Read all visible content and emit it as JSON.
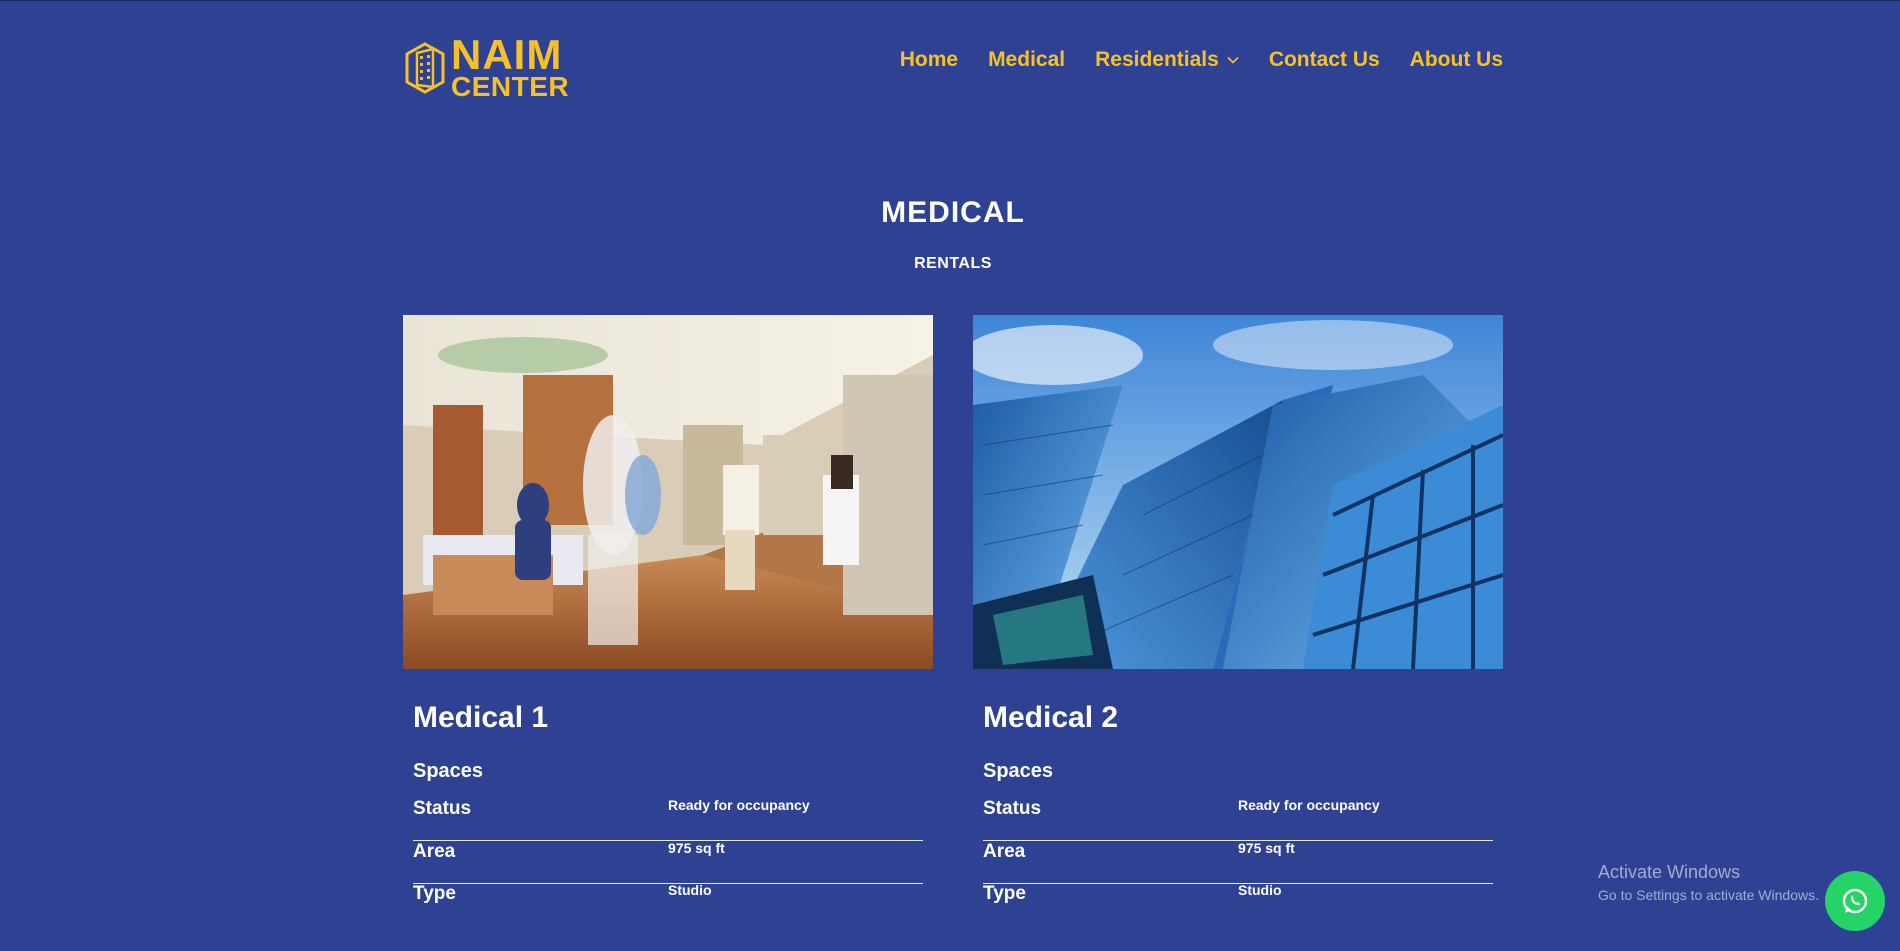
{
  "brand": {
    "line1": "NAIM",
    "line2": "CENTER",
    "accent_color": "#f5c12a",
    "background_color": "#2f4193"
  },
  "nav": {
    "items": [
      {
        "label": "Home"
      },
      {
        "label": "Medical"
      },
      {
        "label": "Residentials",
        "has_dropdown": true
      },
      {
        "label": "Contact Us"
      },
      {
        "label": "About Us"
      }
    ]
  },
  "page": {
    "title": "MEDICAL",
    "subtitle": "RENTALS"
  },
  "listings": [
    {
      "title": "Medical 1",
      "image": "hospital-corridor-photo",
      "section": "Spaces",
      "specs": [
        {
          "label": "Status",
          "value": "Ready for occupancy"
        },
        {
          "label": "Area",
          "value": "975 sq ft"
        },
        {
          "label": "Type",
          "value": "Studio"
        }
      ]
    },
    {
      "title": "Medical 2",
      "image": "glass-skyscrapers-photo",
      "section": "Spaces",
      "specs": [
        {
          "label": "Status",
          "value": "Ready for occupancy"
        },
        {
          "label": "Area",
          "value": "975 sq ft"
        },
        {
          "label": "Type",
          "value": "Studio"
        }
      ]
    }
  ],
  "watermark": {
    "line1": "Activate Windows",
    "line2": "Go to Settings to activate Windows."
  },
  "whatsapp": {
    "icon": "whatsapp-icon",
    "color": "#25d366"
  }
}
